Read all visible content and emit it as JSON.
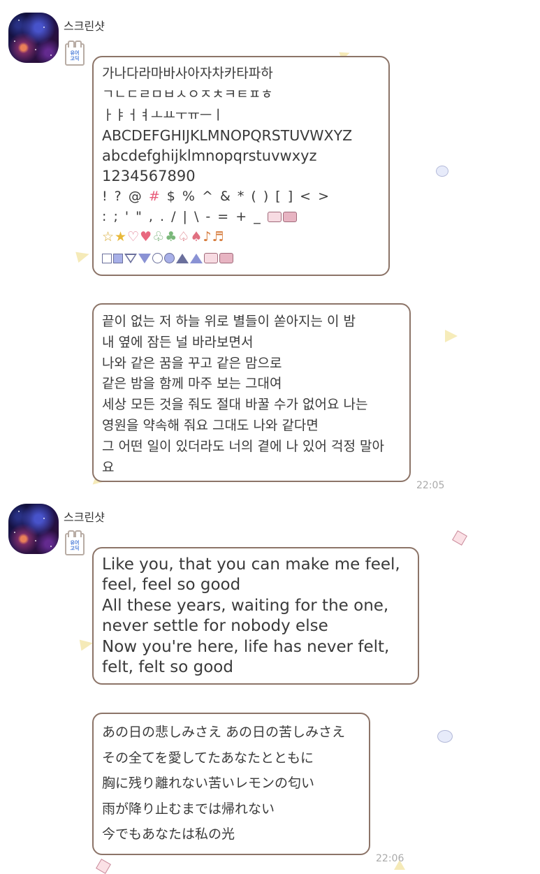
{
  "messages": [
    {
      "sender": "스크린샷",
      "badge_text": "유어마인\n고딕",
      "bubble1": {
        "hangul_syllables": "가나다라마바사아자차카타파하",
        "hangul_consonants": "ㄱㄴㄷㄹㅁㅂㅅㅇㅈㅊㅋㅌㅍㅎ",
        "hangul_vowels": "ㅏㅑㅓㅕㅗㅛㅜㅠㅡㅣ",
        "upper": "ABCDEFGHIJKLMNOPQRSTUVWXYZ",
        "lower": "abcdefghijklmnopqrstuvwxyz",
        "digits": "1234567890",
        "symbols1_a": "! ? @ ",
        "symbols1_hash": "#",
        "symbols1_b": " $ % ^ & * ( ) [ ] < >",
        "symbols2": ": ; ' \" , . / | \\ - = + _",
        "icons_row1": [
          "star-outline",
          "star-filled",
          "heart-outline",
          "heart-filled",
          "club-outline",
          "club-filled",
          "spade-outline",
          "spade-filled",
          "note-single",
          "note-double"
        ],
        "icons_row1_glyphs": [
          "☆",
          "★",
          "♡",
          "♥",
          "♧",
          "♣",
          "♤",
          "♠",
          "♪",
          "♬"
        ],
        "icons_row2": [
          "square-outline",
          "square-filled",
          "triangle-down-outline",
          "triangle-down-filled",
          "circle-outline",
          "circle-filled",
          "triangle-up-outline",
          "triangle-up-filled",
          "phone-outline",
          "phone-filled"
        ]
      },
      "bubble2": [
        "끝이 없는 저 하늘 위로 별들이 쏟아지는 이 밤",
        "내 옆에 잠든 널 바라보면서",
        "나와 같은 꿈을 꾸고 같은 맘으로",
        "같은 밤을 함께 마주 보는 그대여",
        "세상 모든 것을 줘도 절대 바꿀 수가 없어요 나는",
        "영원을 약속해 줘요 그대도 나와 같다면",
        "그 어떤 일이 있더라도 너의 곁에 나 있어 걱정 말아",
        "요"
      ],
      "time": "22:05"
    },
    {
      "sender": "스크린샷",
      "badge_text": "유어마인\n고딕",
      "bubble1": [
        "Like you, that you can make me feel,",
        "feel, feel so good",
        "All these years, waiting for the one,",
        "never settle for nobody else",
        "Now you're here, life has never felt,",
        "felt, felt so good"
      ],
      "bubble2": [
        "あの日の悲しみさえ あの日の苦しみさえ",
        "その全てを愛してたあなたとともに",
        "胸に残り離れない苦いレモンの匂い",
        "雨が降り止むまでは帰れない",
        "今でもあなたは私の光"
      ],
      "time": "22:06"
    }
  ],
  "colors": {
    "bubble_border": "#8c7468",
    "hash_accent": "#e85a78",
    "deco_triangle": "#f5eab8",
    "deco_circle": "#e7ebfa",
    "deco_diamond": "#fbe1e6"
  }
}
